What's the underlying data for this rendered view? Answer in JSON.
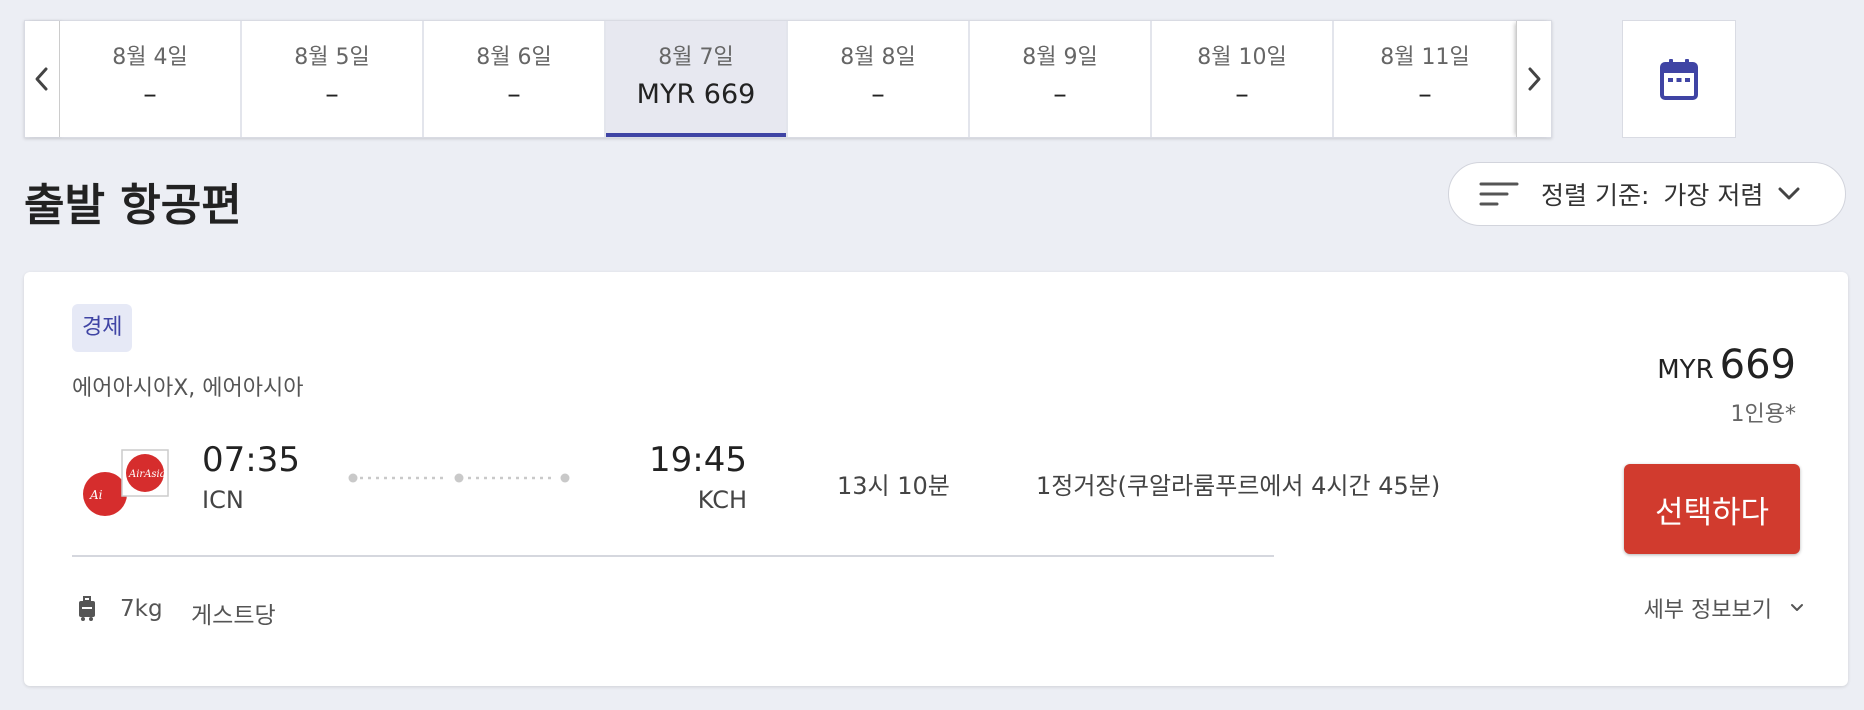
{
  "date_strip": {
    "dates": [
      {
        "label": "8월 4일",
        "price": "–"
      },
      {
        "label": "8월 5일",
        "price": "–"
      },
      {
        "label": "8월 6일",
        "price": "–"
      },
      {
        "label": "8월 7일",
        "price": "MYR 669"
      },
      {
        "label": "8월 8일",
        "price": "–"
      },
      {
        "label": "8월 9일",
        "price": "–"
      },
      {
        "label": "8월 10일",
        "price": "–"
      },
      {
        "label": "8월 11일",
        "price": "–"
      }
    ],
    "selected_index": 3
  },
  "section_title": "출발 항공편",
  "sort": {
    "label": "정렬 기준:",
    "value": "가장 저렴"
  },
  "flight": {
    "cabin": "경제",
    "airlines": "에어아시아X, 에어아시아",
    "departure": {
      "time": "07:35",
      "code": "ICN"
    },
    "arrival": {
      "time": "19:45",
      "code": "KCH"
    },
    "duration": "13시 10분",
    "stops": "1정거장(쿠알라룸푸르에서 4시간 45분)",
    "price_currency": "MYR",
    "price_amount": "669",
    "per_person": "1인용*",
    "select_label": "선택하다",
    "baggage_weight": "7kg",
    "baggage_unit": "게스트당",
    "details_label": "세부 정보보기"
  },
  "colors": {
    "accent": "#3f44a4",
    "select_button": "#d13b2e",
    "background": "#eceef4"
  }
}
